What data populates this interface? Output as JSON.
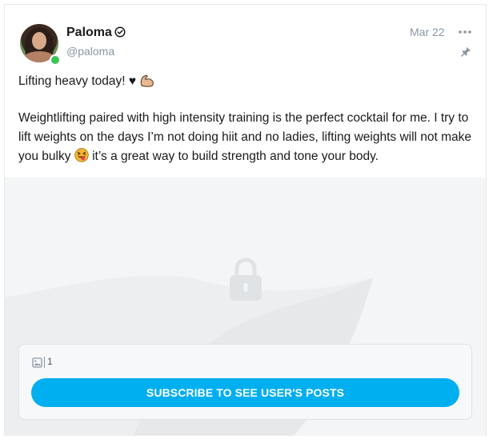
{
  "post": {
    "author_name": "Paloma",
    "author_handle": "@paloma",
    "date": "Mar 22",
    "line1": "Lifting heavy today! ♥",
    "body_part1": "Weightlifting paired with high intensity training is the perfect cocktail for me. I try to lift weights on the days I’m not doing hiit and no ladies, lifting weights will not make you bulky ",
    "body_part2": " it’s a great way to build strength and tone your body."
  },
  "locked": {
    "media_count": "1",
    "subscribe_label": "SUBSCRIBE TO SEE USER'S POSTS"
  },
  "icons": {
    "verified": "verified-badge-icon",
    "more": "more-options-icon",
    "pin": "pin-icon",
    "lock": "lock-icon",
    "media": "image-icon",
    "muscle": "flexed-biceps-emoji",
    "emoji": "squinting-tongue-emoji"
  },
  "colors": {
    "accent": "#00aff0",
    "muted": "#8a96a3",
    "online": "#3cc45a"
  }
}
